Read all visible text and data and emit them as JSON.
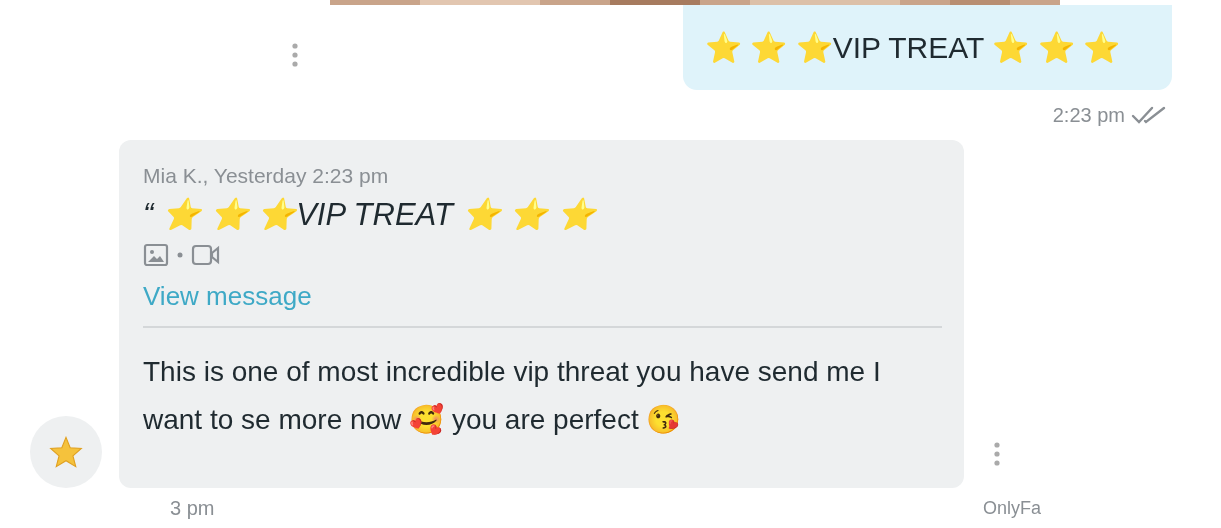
{
  "sent_message": {
    "text": "⭐ ⭐ ⭐VIP TREAT ⭐ ⭐ ⭐",
    "time": "2:23 pm",
    "read": true
  },
  "received_message": {
    "quote": {
      "author": "Mia K., Yesterday 2:23 pm",
      "text": "“ ⭐ ⭐ ⭐VIP TREAT ⭐ ⭐ ⭐",
      "link": "View message"
    },
    "text": "This is one of most incredible vip threat you have send me I want to se more now 🥰 you are perfect 😘",
    "time": "3 pm"
  },
  "footer": {
    "text": "OnlyFa"
  }
}
